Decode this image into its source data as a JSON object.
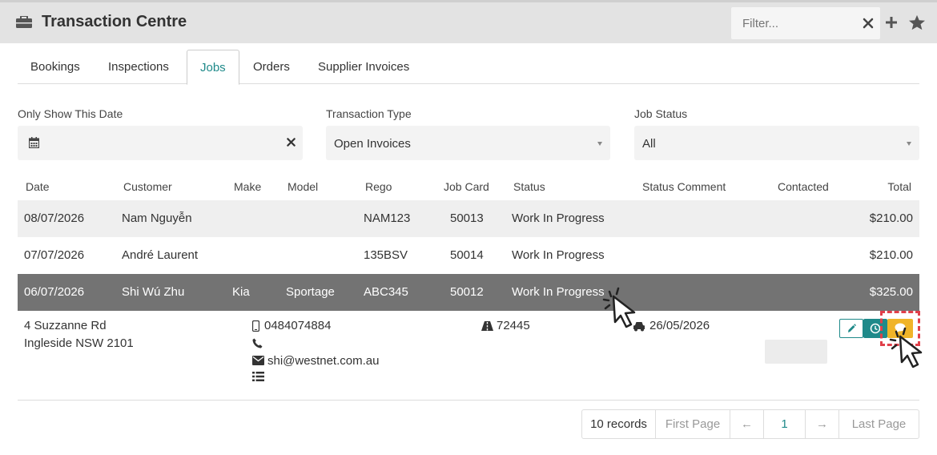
{
  "header": {
    "title": "Transaction Centre",
    "filter_placeholder": "Filter..."
  },
  "tabs": [
    {
      "label": "Bookings",
      "active": false
    },
    {
      "label": "Inspections",
      "active": false
    },
    {
      "label": "Jobs",
      "active": true
    },
    {
      "label": "Orders",
      "active": false
    },
    {
      "label": "Supplier Invoices",
      "active": false
    }
  ],
  "filters": {
    "date": {
      "label": "Only Show This Date",
      "value": ""
    },
    "transaction_type": {
      "label": "Transaction Type",
      "value": "Open Invoices"
    },
    "job_status": {
      "label": "Job Status",
      "value": "All"
    }
  },
  "table": {
    "columns": [
      "Date",
      "Customer",
      "Make",
      "Model",
      "Rego",
      "Job Card",
      "Status",
      "Status Comment",
      "Contacted",
      "Total"
    ],
    "rows": [
      {
        "date": "08/07/2026",
        "customer": "Nam Nguyễn",
        "make": "",
        "model": "",
        "rego": "NAM123",
        "job_card": "50013",
        "status": "Work In Progress",
        "status_comment": "",
        "contacted": "",
        "total": "$210.00"
      },
      {
        "date": "07/07/2026",
        "customer": "André Laurent",
        "make": "",
        "model": "",
        "rego": "135BSV",
        "job_card": "50014",
        "status": "Work In Progress",
        "status_comment": "",
        "contacted": "",
        "total": "$210.00"
      },
      {
        "date": "06/07/2026",
        "customer": "Shi Wú Zhu",
        "make": "Kia",
        "model": "Sportage",
        "rego": "ABC345",
        "job_card": "50012",
        "status": "Work In Progress",
        "status_comment": "",
        "contacted": "",
        "total": "$325.00"
      }
    ]
  },
  "detail": {
    "address_line1": "4 Suzzanne Rd",
    "address_line2": "Ingleside NSW 2101",
    "mobile": "0484074884",
    "phone": "",
    "email": "shi@westnet.com.au",
    "odometer": "72445",
    "service_date": "26/05/2026"
  },
  "pager": {
    "records": "10 records",
    "first": "First Page",
    "prev": "←",
    "page": "1",
    "next": "→",
    "last": "Last Page"
  },
  "colors": {
    "accent": "#1f8a8a",
    "selected_row": "#737373",
    "warning_button": "#f0b429",
    "focus_ring": "#e0404a"
  }
}
